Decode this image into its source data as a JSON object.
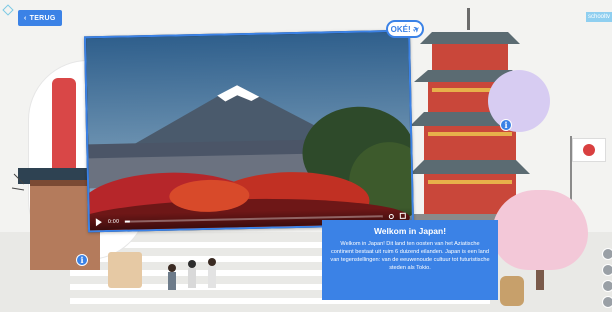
{
  "nav": {
    "back_label": "TERUG",
    "back_icon": "chevron-left-icon",
    "logo_text": "schooltv"
  },
  "video": {
    "current_time": "0:00",
    "progress": 0.02,
    "icons": [
      "play-icon",
      "settings-icon",
      "fullscreen-icon"
    ]
  },
  "badge": {
    "label": "OKÉ!",
    "icon": "airplane-icon"
  },
  "info_card": {
    "title": "Welkom in Japan!",
    "body": "Welkom in Japan! Dit land ten oosten van het Aziatische continent bestaat uit ruim 6 duizend eilanden. Japan is een land van tegenstellingen: van de eeuwenoude cultuur tot futuristische steden als Tokio."
  },
  "hotspots": [
    "info-icon",
    "info-icon"
  ],
  "colors": {
    "accent": "#3b82e6",
    "background": "#f3f3f1",
    "cherry_blossom": "#f3c8d8",
    "pagoda_red": "#c9473a"
  }
}
